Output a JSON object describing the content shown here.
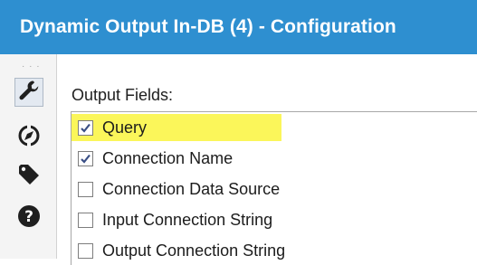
{
  "window": {
    "title": "Dynamic Output In-DB (4) - Configuration"
  },
  "sidebar": {
    "tools": [
      {
        "icon": "wrench-icon",
        "active": true
      },
      {
        "icon": "navigator-icon",
        "active": false
      },
      {
        "icon": "tag-icon",
        "active": false
      },
      {
        "icon": "help-icon",
        "active": false
      }
    ]
  },
  "main": {
    "section_label": "Output Fields:",
    "fields": [
      {
        "label": "Query",
        "checked": true,
        "highlighted": true
      },
      {
        "label": "Connection Name",
        "checked": true,
        "highlighted": false
      },
      {
        "label": "Connection Data Source",
        "checked": false,
        "highlighted": false
      },
      {
        "label": "Input Connection String",
        "checked": false,
        "highlighted": false
      },
      {
        "label": "Output Connection String",
        "checked": false,
        "highlighted": false
      }
    ]
  },
  "colors": {
    "titlebar": "#2e8fd0",
    "highlight": "#fbf65a",
    "checkmark": "#3a4f86"
  }
}
